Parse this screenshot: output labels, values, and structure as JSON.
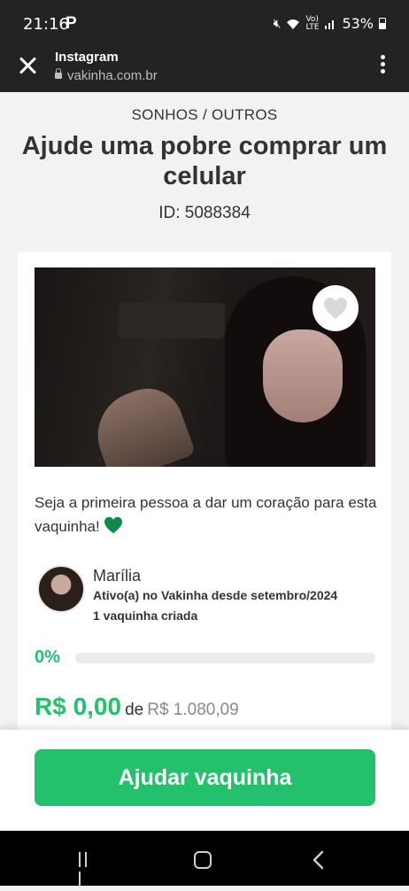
{
  "status_bar": {
    "time": "21:16",
    "battery": "53%",
    "icons": [
      "p-app-icon",
      "mute-icon",
      "wifi-icon",
      "volte-icon",
      "signal-icon",
      "battery-icon"
    ]
  },
  "browser": {
    "app_name": "Instagram",
    "url": "vakinha.com.br"
  },
  "campaign": {
    "category": "SONHOS / OUTROS",
    "title": "Ajude uma pobre comprar um celular",
    "id_label": "ID: 5088384",
    "cta_text": "Seja a primeira pessoa a dar um coração para esta vaquinha!",
    "author": {
      "name": "Marília",
      "since": "Ativo(a) no Vakinha desde setembro/2024",
      "created": "1 vaquinha criada"
    },
    "progress": {
      "percent_label": "0%",
      "value": 0
    },
    "raised": "R$ 0,00",
    "of": "de",
    "goal": "R$ 1.080,09"
  },
  "action": {
    "help_button": "Ajudar vaquinha"
  },
  "colors": {
    "brand_green": "#23c16b",
    "dark_bar": "#232323"
  }
}
